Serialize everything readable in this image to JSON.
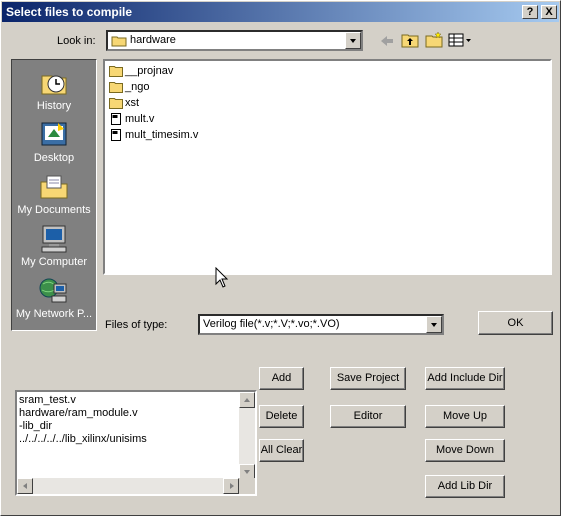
{
  "dialog": {
    "title": "Select files to compile",
    "help_glyph": "?",
    "close_glyph": "X"
  },
  "lookin": {
    "label": "Look in:",
    "value": "hardware"
  },
  "places": [
    {
      "label": "History",
      "icon": "history-icon"
    },
    {
      "label": "Desktop",
      "icon": "desktop-icon"
    },
    {
      "label": "My Documents",
      "icon": "my-documents-icon"
    },
    {
      "label": "My Computer",
      "icon": "my-computer-icon"
    },
    {
      "label": "My Network P...",
      "icon": "my-network-places-icon"
    }
  ],
  "files": [
    {
      "name": "__projnav",
      "type": "folder"
    },
    {
      "name": "_ngo",
      "type": "folder"
    },
    {
      "name": "xst",
      "type": "folder"
    },
    {
      "name": "mult.v",
      "type": "file"
    },
    {
      "name": "mult_timesim.v",
      "type": "file"
    }
  ],
  "filetype": {
    "label": "Files of type:",
    "value": "Verilog file(*.v;*.V;*.vo;*.VO)"
  },
  "buttons": {
    "ok": "OK",
    "add": "Add",
    "delete": "Delete",
    "all_clear": "All Clear",
    "save_project": "Save Project",
    "editor": "Editor",
    "add_include_dir": "Add Include Dir",
    "move_up": "Move Up",
    "move_down": "Move Down",
    "add_lib_dir": "Add Lib Dir"
  },
  "compile_list": [
    "sram_test.v",
    "hardware/ram_module.v",
    "-lib_dir",
    "../../../../../lib_xilinx/unisims"
  ],
  "colors": {
    "face": "#d4d0c8",
    "title_start": "#0a246a",
    "title_end": "#a6caf0",
    "places_bg": "#808080",
    "folder": "#f7d774"
  }
}
